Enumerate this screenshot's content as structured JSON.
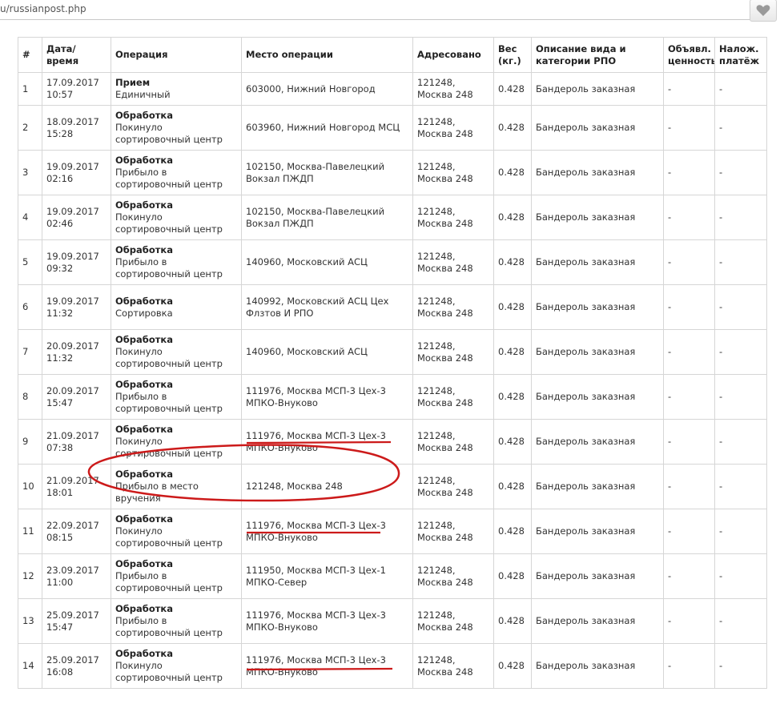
{
  "browser": {
    "url_fragment": "u/russianpost.php",
    "favorite_icon": "heart-icon"
  },
  "table": {
    "headers": {
      "num": "#",
      "datetime": "Дата/время",
      "operation": "Операция",
      "location": "Место операции",
      "addressed": "Адресовано",
      "weight": "Вес (кг.)",
      "description": "Описание вида и категории РПО",
      "declared_value": "Объявл. ценность",
      "cod": "Налож. платёж"
    },
    "rows": [
      {
        "num": "1",
        "date": "17.09.2017",
        "time": "10:57",
        "op_type": "Прием",
        "op_attr": "Единичный",
        "location": "603000, Нижний Новгород",
        "addressed": "121248, Москва 248",
        "weight": "0.428",
        "description": "Бандероль заказная",
        "declared_value": "-",
        "cod": "-"
      },
      {
        "num": "2",
        "date": "18.09.2017",
        "time": "15:28",
        "op_type": "Обработка",
        "op_attr": "Покинуло сортировочный центр",
        "location": "603960, Нижний Новгород МСЦ",
        "addressed": "121248, Москва 248",
        "weight": "0.428",
        "description": "Бандероль заказная",
        "declared_value": "-",
        "cod": "-"
      },
      {
        "num": "3",
        "date": "19.09.2017",
        "time": "02:16",
        "op_type": "Обработка",
        "op_attr": "Прибыло в сортировочный центр",
        "location": "102150, Москва-Павелецкий Вокзал ПЖДП",
        "addressed": "121248, Москва 248",
        "weight": "0.428",
        "description": "Бандероль заказная",
        "declared_value": "-",
        "cod": "-"
      },
      {
        "num": "4",
        "date": "19.09.2017",
        "time": "02:46",
        "op_type": "Обработка",
        "op_attr": "Покинуло сортировочный центр",
        "location": "102150, Москва-Павелецкий Вокзал ПЖДП",
        "addressed": "121248, Москва 248",
        "weight": "0.428",
        "description": "Бандероль заказная",
        "declared_value": "-",
        "cod": "-"
      },
      {
        "num": "5",
        "date": "19.09.2017",
        "time": "09:32",
        "op_type": "Обработка",
        "op_attr": "Прибыло в сортировочный центр",
        "location": "140960, Московский АСЦ",
        "addressed": "121248, Москва 248",
        "weight": "0.428",
        "description": "Бандероль заказная",
        "declared_value": "-",
        "cod": "-"
      },
      {
        "num": "6",
        "date": "19.09.2017",
        "time": "11:32",
        "op_type": "Обработка",
        "op_attr": "Сортировка",
        "location": "140992, Московский АСЦ Цех Флзтов И РПО",
        "addressed": "121248, Москва 248",
        "weight": "0.428",
        "description": "Бандероль заказная",
        "declared_value": "-",
        "cod": "-"
      },
      {
        "num": "7",
        "date": "20.09.2017",
        "time": "11:32",
        "op_type": "Обработка",
        "op_attr": "Покинуло сортировочный центр",
        "location": "140960, Московский АСЦ",
        "addressed": "121248, Москва 248",
        "weight": "0.428",
        "description": "Бандероль заказная",
        "declared_value": "-",
        "cod": "-"
      },
      {
        "num": "8",
        "date": "20.09.2017",
        "time": "15:47",
        "op_type": "Обработка",
        "op_attr": "Прибыло в сортировочный центр",
        "location": "111976, Москва МСП-3 Цех-3 МПКО-Внуково",
        "addressed": "121248, Москва 248",
        "weight": "0.428",
        "description": "Бандероль заказная",
        "declared_value": "-",
        "cod": "-"
      },
      {
        "num": "9",
        "date": "21.09.2017",
        "time": "07:38",
        "op_type": "Обработка",
        "op_attr": "Покинуло сортировочный центр",
        "location": "111976, Москва МСП-3 Цех-3 МПКО-Внуково",
        "addressed": "121248, Москва 248",
        "weight": "0.428",
        "description": "Бандероль заказная",
        "declared_value": "-",
        "cod": "-"
      },
      {
        "num": "10",
        "date": "21.09.2017",
        "time": "18:01",
        "op_type": "Обработка",
        "op_attr": "Прибыло в место вручения",
        "location": "121248, Москва 248",
        "addressed": "121248, Москва 248",
        "weight": "0.428",
        "description": "Бандероль заказная",
        "declared_value": "-",
        "cod": "-"
      },
      {
        "num": "11",
        "date": "22.09.2017",
        "time": "08:15",
        "op_type": "Обработка",
        "op_attr": "Покинуло сортировочный центр",
        "location": "111976, Москва МСП-3 Цех-3 МПКО-Внуково",
        "addressed": "121248, Москва 248",
        "weight": "0.428",
        "description": "Бандероль заказная",
        "declared_value": "-",
        "cod": "-"
      },
      {
        "num": "12",
        "date": "23.09.2017",
        "time": "11:00",
        "op_type": "Обработка",
        "op_attr": "Прибыло в сортировочный центр",
        "location": "111950, Москва МСП-3 Цех-1 МПКО-Север",
        "addressed": "121248, Москва 248",
        "weight": "0.428",
        "description": "Бандероль заказная",
        "declared_value": "-",
        "cod": "-"
      },
      {
        "num": "13",
        "date": "25.09.2017",
        "time": "15:47",
        "op_type": "Обработка",
        "op_attr": "Прибыло в сортировочный центр",
        "location": "111976, Москва МСП-3 Цех-3 МПКО-Внуково",
        "addressed": "121248, Москва 248",
        "weight": "0.428",
        "description": "Бандероль заказная",
        "declared_value": "-",
        "cod": "-"
      },
      {
        "num": "14",
        "date": "25.09.2017",
        "time": "16:08",
        "op_type": "Обработка",
        "op_attr": "Покинуло сортировочный центр",
        "location": "111976, Москва МСП-3 Цех-3 МПКО-Внуково",
        "addressed": "121248, Москва 248",
        "weight": "0.428",
        "description": "Бандероль заказная",
        "declared_value": "-",
        "cod": "-"
      }
    ]
  },
  "annotations": {
    "color": "#cc1a1a",
    "circled_row": "10",
    "underlined_rows": [
      "9",
      "11",
      "14"
    ]
  }
}
